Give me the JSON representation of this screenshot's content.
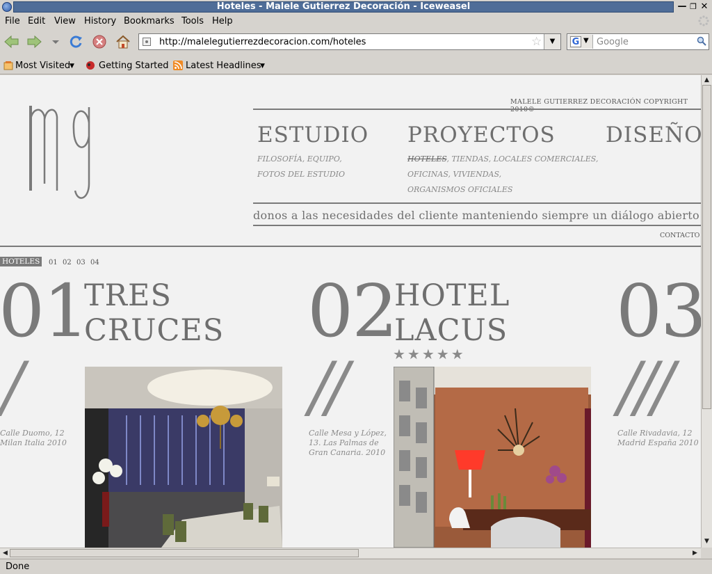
{
  "window": {
    "title": "Hoteles - Malele Gutierrez Decoración - Iceweasel"
  },
  "menu": [
    "File",
    "Edit",
    "View",
    "History",
    "Bookmarks",
    "Tools",
    "Help"
  ],
  "nav": {
    "url": "http://malelegutierrezdecoracion.com/hoteles",
    "search_placeholder": "Google"
  },
  "bookmarks": [
    "Most Visited",
    "Getting Started",
    "Latest Headlines"
  ],
  "page": {
    "copyright": "MALELE GUTIERREZ DECORACIÓN COPYRIGHT 2010©",
    "menu": [
      {
        "title": "ESTUDIO",
        "sub": [
          "FILOSOFÍA, EQUIPO,",
          "FOTOS DEL ESTUDIO"
        ]
      },
      {
        "title": "PROYECTOS",
        "sub_active": "HOTELES",
        "sub_rest": ", TIENDAS, LOCALES COMERCIALES,",
        "sub": [
          "OFICINAS, VIVIENDAS,",
          "ORGANISMOS OFICIALES"
        ]
      },
      {
        "title": "DISEÑO"
      }
    ],
    "ticker": "donos a las necesidades del cliente manteniendo siempre un diálogo abierto",
    "contacto": "CONTACTO",
    "tag": "HOTELES",
    "pages": [
      "01",
      "02",
      "03",
      "04"
    ],
    "hotels": [
      {
        "num": "01",
        "name1": "TRES",
        "name2": "CRUCES",
        "slash": "/",
        "addr": [
          "Calle Duomo, 12",
          "Milan Italia 2010"
        ]
      },
      {
        "num": "02",
        "name1": "HOTEL",
        "name2": "LACUS",
        "stars": "★★★★★",
        "slash": "//",
        "addr": [
          "Calle Mesa y López,",
          "13. Las Palmas de",
          "Gran Canaria. 2010"
        ]
      },
      {
        "num": "03",
        "slash": "///",
        "addr": [
          "Calle Rivadavia, 12",
          "Madrid España 2010"
        ]
      }
    ]
  },
  "status": "Done"
}
